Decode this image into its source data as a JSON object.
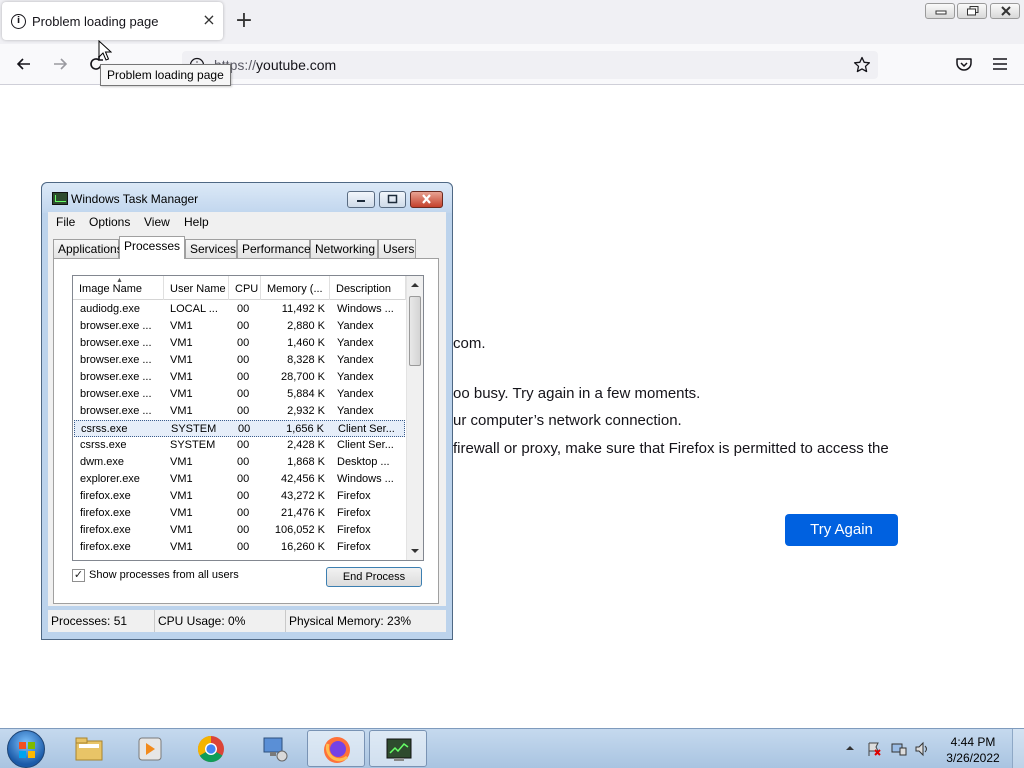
{
  "browser": {
    "tab_title": "Problem loading page",
    "tab_close": "×",
    "new_tab": "+",
    "url_scheme": "https://",
    "url_host": "youtube.com",
    "tooltip": "Problem loading page"
  },
  "error_page": {
    "line_host": "com.",
    "line_busy": "oo busy. Try again in a few moments.",
    "line_network": "ur computer’s network connection.",
    "line_firewall": " firewall or proxy, make sure that Firefox is permitted to access the",
    "try_again": "Try Again"
  },
  "task_manager": {
    "title": "Windows Task Manager",
    "menu": [
      "File",
      "Options",
      "View",
      "Help"
    ],
    "tabs": [
      "Applications",
      "Processes",
      "Services",
      "Performance",
      "Networking",
      "Users"
    ],
    "active_tab": "Processes",
    "columns": [
      "Image Name",
      "User Name",
      "CPU",
      "Memory (...",
      "Description"
    ],
    "rows": [
      [
        "audiodg.exe",
        "LOCAL ...",
        "00",
        "11,492 K",
        "Windows ..."
      ],
      [
        "browser.exe ...",
        "VM1",
        "00",
        "2,880 K",
        "Yandex"
      ],
      [
        "browser.exe ...",
        "VM1",
        "00",
        "1,460 K",
        "Yandex"
      ],
      [
        "browser.exe ...",
        "VM1",
        "00",
        "8,328 K",
        "Yandex"
      ],
      [
        "browser.exe ...",
        "VM1",
        "00",
        "28,700 K",
        "Yandex"
      ],
      [
        "browser.exe ...",
        "VM1",
        "00",
        "5,884 K",
        "Yandex"
      ],
      [
        "browser.exe ...",
        "VM1",
        "00",
        "2,932 K",
        "Yandex"
      ],
      [
        "csrss.exe",
        "SYSTEM",
        "00",
        "1,656 K",
        "Client Ser..."
      ],
      [
        "csrss.exe",
        "SYSTEM",
        "00",
        "2,428 K",
        "Client Ser..."
      ],
      [
        "dwm.exe",
        "VM1",
        "00",
        "1,868 K",
        "Desktop ..."
      ],
      [
        "explorer.exe",
        "VM1",
        "00",
        "42,456 K",
        "Windows ..."
      ],
      [
        "firefox.exe",
        "VM1",
        "00",
        "43,272 K",
        "Firefox"
      ],
      [
        "firefox.exe",
        "VM1",
        "00",
        "21,476 K",
        "Firefox"
      ],
      [
        "firefox.exe",
        "VM1",
        "00",
        "106,052 K",
        "Firefox"
      ],
      [
        "firefox.exe",
        "VM1",
        "00",
        "16,260 K",
        "Firefox"
      ]
    ],
    "selected_row": 7,
    "show_all_label": "Show processes from all users",
    "show_all_checked": "✓",
    "end_process": "End Process",
    "status": {
      "processes": "Processes: 51",
      "cpu": "CPU Usage: 0%",
      "memory": "Physical Memory: 23%"
    }
  },
  "taskbar": {
    "time": "4:44 PM",
    "date": "3/26/2022"
  },
  "colors": {
    "accent": "#0061e0",
    "taskbar": "#b8d0ea",
    "tm_frame": "#bcd3ec"
  }
}
